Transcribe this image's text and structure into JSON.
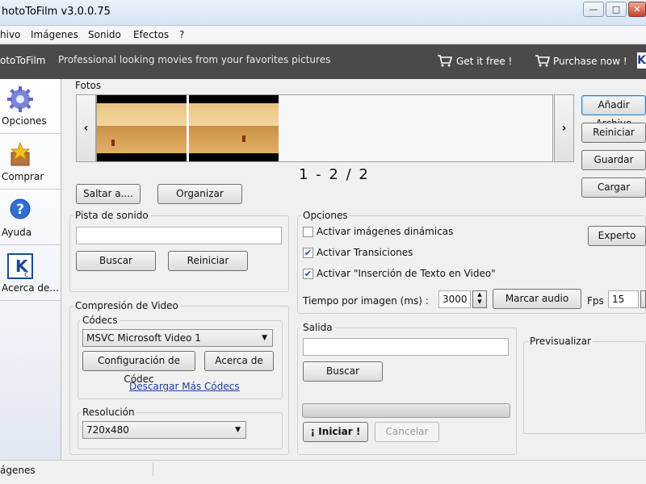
{
  "window": {
    "title": "hotoToFilm v3.0.0.75",
    "min_btn": "—",
    "max_btn": "□",
    "close_btn": "✕"
  },
  "menu": [
    "hivo",
    "Imágenes",
    "Sonido",
    "Efectos",
    "?"
  ],
  "banner": {
    "brand": "otoToFilm",
    "tagline": "Professional looking movies from your favorites pictures",
    "get_it_free": "Get it free !",
    "purchase": "Purchase now !",
    "edge_logo": "K"
  },
  "sidebar": {
    "items": [
      {
        "label": "Opciones",
        "icon": "gear-icon"
      },
      {
        "label": "Comprar",
        "icon": "star-box-icon"
      },
      {
        "label": "Ayuda",
        "icon": "help-icon"
      },
      {
        "label": "Acerca de...",
        "icon": "kc-logo-icon"
      }
    ]
  },
  "fotos": {
    "label": "Fotos",
    "prev": "‹",
    "next": "›",
    "pager": "1 - 2 / 2",
    "saltar": "Saltar a....",
    "organizar": "Organizar"
  },
  "right_buttons": {
    "anadir": "Añadir Archivo",
    "reiniciar": "Reiniciar",
    "guardar": "Guardar",
    "cargar": "Cargar"
  },
  "sonido": {
    "label": "Pista de sonido",
    "value": "",
    "buscar": "Buscar",
    "reiniciar": "Reiniciar"
  },
  "opciones": {
    "label": "Opciones",
    "checks": [
      {
        "label": "Activar imágenes dinámicas",
        "checked": false
      },
      {
        "label": "Activar Transiciones",
        "checked": true
      },
      {
        "label": "Activar \"Inserción de Texto en Video\"",
        "checked": true
      }
    ],
    "experto": "Experto",
    "tiempo_label": "Tiempo por imagen (ms) :",
    "tiempo_value": "3000",
    "marcar_audio": "Marcar audio",
    "fps_label": "Fps :",
    "fps_value": "15"
  },
  "compresion": {
    "label": "Compresión de Video",
    "codecs_label": "Códecs",
    "codec_selected": "MSVC Microsoft Video 1",
    "config_btn": "Configuración de Códec",
    "acerca_btn": "Acerca de",
    "descargar_link": "Descargar Más Códecs",
    "resolucion_label": "Resolución",
    "resolucion_selected": "720x480"
  },
  "salida": {
    "label": "Salida",
    "value": "",
    "buscar": "Buscar",
    "iniciar": "¡ Iniciar !",
    "cancelar": "Cancelar",
    "progress": 0
  },
  "preview": {
    "label": "Previsualizar"
  },
  "status": {
    "text": "ágenes"
  }
}
